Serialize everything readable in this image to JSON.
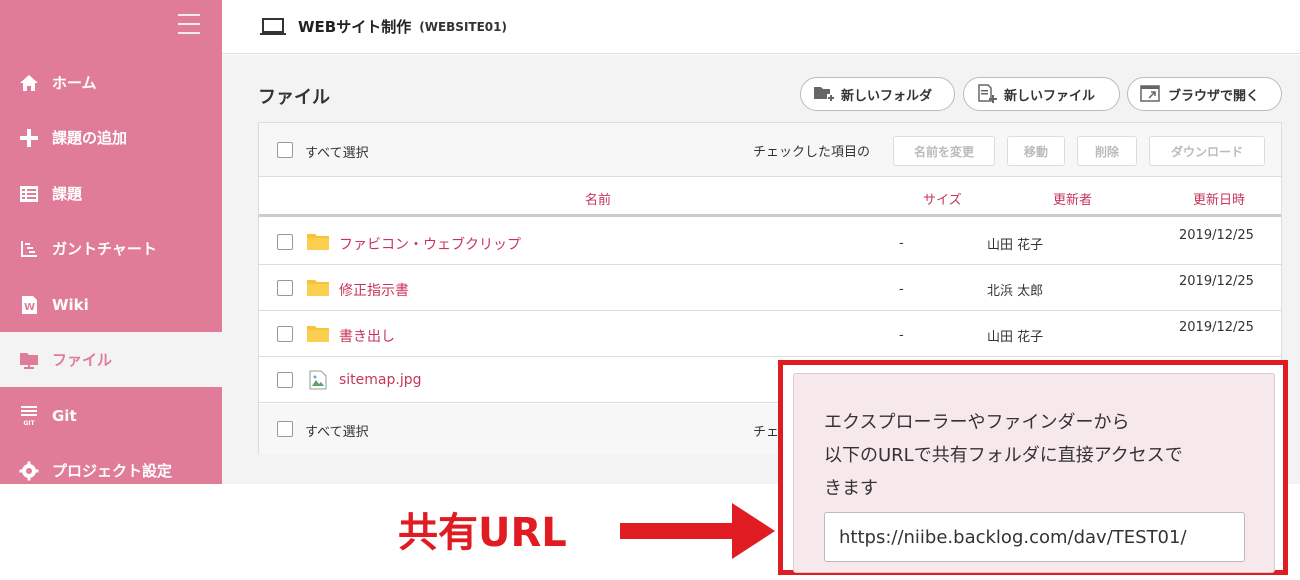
{
  "project": {
    "name": "WEBサイト制作",
    "key": "(WEBSITE01)"
  },
  "sidebar": {
    "items": [
      {
        "label": "ホーム",
        "icon": "home-icon"
      },
      {
        "label": "課題の追加",
        "icon": "plus-icon"
      },
      {
        "label": "課題",
        "icon": "list-icon"
      },
      {
        "label": "ガントチャート",
        "icon": "gantt-icon"
      },
      {
        "label": "Wiki",
        "icon": "wiki-icon"
      },
      {
        "label": "ファイル",
        "icon": "folder-icon",
        "active": true
      },
      {
        "label": "Git",
        "icon": "git-icon"
      },
      {
        "label": "プロジェクト設定",
        "icon": "gear-icon"
      }
    ]
  },
  "files": {
    "title": "ファイル",
    "buttons": {
      "new_folder": "新しいフォルダ",
      "new_file": "新しいファイル",
      "open_browser": "ブラウザで開く"
    },
    "toolbar": {
      "select_all": "すべて選択",
      "checked_items": "チェックした項目の",
      "rename": "名前を変更",
      "move": "移動",
      "delete": "削除",
      "download": "ダウンロード"
    },
    "columns": {
      "name": "名前",
      "size": "サイズ",
      "updater": "更新者",
      "updated": "更新日時"
    },
    "rows": [
      {
        "name": "ファビコン・ウェブクリップ",
        "type": "folder",
        "size": "-",
        "updater": "山田 花子",
        "updated": "2019/12/25"
      },
      {
        "name": "修正指示書",
        "type": "folder",
        "size": "-",
        "updater": "北浜 太郎",
        "updated": "2019/12/25"
      },
      {
        "name": "書き出し",
        "type": "folder",
        "size": "-",
        "updater": "山田 花子",
        "updated": "2019/12/25"
      },
      {
        "name": "sitemap.jpg",
        "type": "image"
      }
    ],
    "footer": {
      "select_all": "すべて選択",
      "checked_partial": "チェ"
    }
  },
  "callout": {
    "line1": "エクスプローラーやファインダーから",
    "line2": "以下のURLで共有フォルダに直接アクセスで",
    "line3": "きます",
    "url": "https://niibe.backlog.com/dav/TEST01/"
  },
  "annotation": {
    "label": "共有URL"
  },
  "colors": {
    "sidebar": "#e07c97",
    "link": "#c8355a",
    "highlight": "#e01b22",
    "folder": "#f8c33a"
  }
}
